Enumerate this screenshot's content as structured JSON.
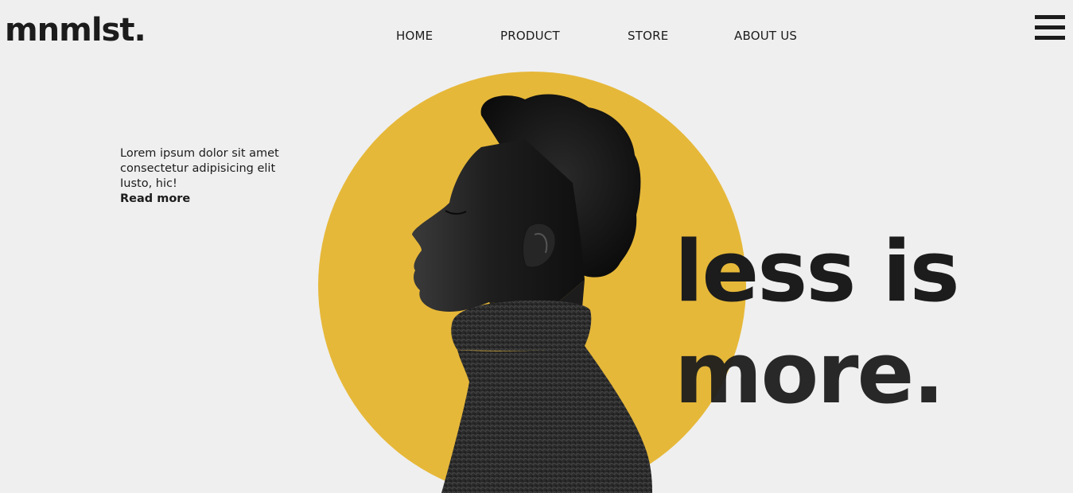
{
  "brand": {
    "logo_text": "mnmlst."
  },
  "nav": {
    "items": [
      {
        "label": "HOME"
      },
      {
        "label": "PRODUCT"
      },
      {
        "label": "STORE"
      },
      {
        "label": "ABOUT US"
      }
    ]
  },
  "intro": {
    "text_line1": "Lorem ipsum dolor sit amet",
    "text_line2": "consectetur adipisicing elit",
    "text_line3": "Iusto, hic!",
    "read_more": "Read more"
  },
  "hero": {
    "headline_line1": "less is",
    "headline_line2": "more.",
    "accent_color": "#e6b839",
    "image_subject": "profile portrait of a person in a black turtleneck"
  }
}
